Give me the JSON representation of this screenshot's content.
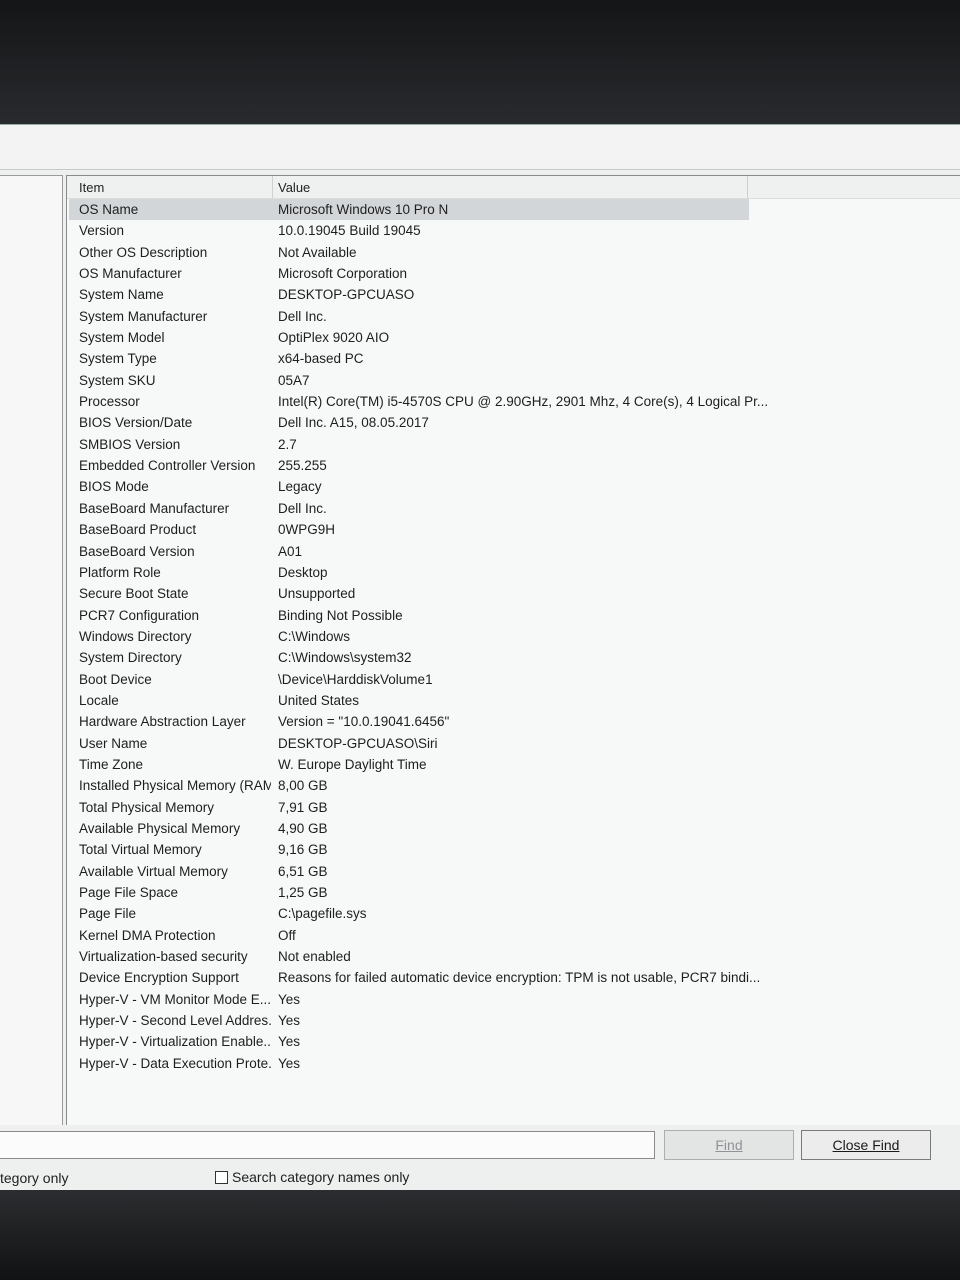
{
  "list": {
    "headers": {
      "item": "Item",
      "value": "Value"
    },
    "rows": [
      {
        "item": "OS Name",
        "value": "Microsoft Windows 10 Pro N"
      },
      {
        "item": "Version",
        "value": "10.0.19045 Build 19045"
      },
      {
        "item": "Other OS Description",
        "value": "Not Available"
      },
      {
        "item": "OS Manufacturer",
        "value": "Microsoft Corporation"
      },
      {
        "item": "System Name",
        "value": "DESKTOP-GPCUASO"
      },
      {
        "item": "System Manufacturer",
        "value": "Dell Inc."
      },
      {
        "item": "System Model",
        "value": "OptiPlex 9020 AIO"
      },
      {
        "item": "System Type",
        "value": "x64-based PC"
      },
      {
        "item": "System SKU",
        "value": "05A7"
      },
      {
        "item": "Processor",
        "value": "Intel(R) Core(TM) i5-4570S CPU @ 2.90GHz, 2901 Mhz, 4 Core(s), 4 Logical Pr..."
      },
      {
        "item": "BIOS Version/Date",
        "value": "Dell Inc. A15, 08.05.2017"
      },
      {
        "item": "SMBIOS Version",
        "value": "2.7"
      },
      {
        "item": "Embedded Controller Version",
        "value": "255.255"
      },
      {
        "item": "BIOS Mode",
        "value": "Legacy"
      },
      {
        "item": "BaseBoard Manufacturer",
        "value": "Dell Inc."
      },
      {
        "item": "BaseBoard Product",
        "value": "0WPG9H"
      },
      {
        "item": "BaseBoard Version",
        "value": "A01"
      },
      {
        "item": "Platform Role",
        "value": "Desktop"
      },
      {
        "item": "Secure Boot State",
        "value": "Unsupported"
      },
      {
        "item": "PCR7 Configuration",
        "value": "Binding Not Possible"
      },
      {
        "item": "Windows Directory",
        "value": "C:\\Windows"
      },
      {
        "item": "System Directory",
        "value": "C:\\Windows\\system32"
      },
      {
        "item": "Boot Device",
        "value": "\\Device\\HarddiskVolume1"
      },
      {
        "item": "Locale",
        "value": "United States"
      },
      {
        "item": "Hardware Abstraction Layer",
        "value": "Version = \"10.0.19041.6456\""
      },
      {
        "item": "User Name",
        "value": "DESKTOP-GPCUASO\\Siri"
      },
      {
        "item": "Time Zone",
        "value": "W. Europe Daylight Time"
      },
      {
        "item": "Installed Physical Memory (RAM)",
        "value": "8,00 GB"
      },
      {
        "item": "Total Physical Memory",
        "value": "7,91 GB"
      },
      {
        "item": "Available Physical Memory",
        "value": "4,90 GB"
      },
      {
        "item": "Total Virtual Memory",
        "value": "9,16 GB"
      },
      {
        "item": "Available Virtual Memory",
        "value": "6,51 GB"
      },
      {
        "item": "Page File Space",
        "value": "1,25 GB"
      },
      {
        "item": "Page File",
        "value": "C:\\pagefile.sys"
      },
      {
        "item": "Kernel DMA Protection",
        "value": "Off"
      },
      {
        "item": "Virtualization-based security",
        "value": "Not enabled"
      },
      {
        "item": "Device Encryption Support",
        "value": "Reasons for failed automatic device encryption: TPM is not usable, PCR7 bindi..."
      },
      {
        "item": "Hyper-V - VM Monitor Mode E...",
        "value": "Yes"
      },
      {
        "item": "Hyper-V - Second Level Addres...",
        "value": "Yes"
      },
      {
        "item": "Hyper-V - Virtualization Enable...",
        "value": "Yes"
      },
      {
        "item": "Hyper-V - Data Execution Prote...",
        "value": "Yes"
      }
    ]
  },
  "find_bar": {
    "find_input_value": "",
    "find_button": "Find",
    "close_find_button": "Close Find",
    "option_left_label": "tegory only",
    "search_category_names_label": "Search category names only",
    "search_category_names_checked": false
  }
}
